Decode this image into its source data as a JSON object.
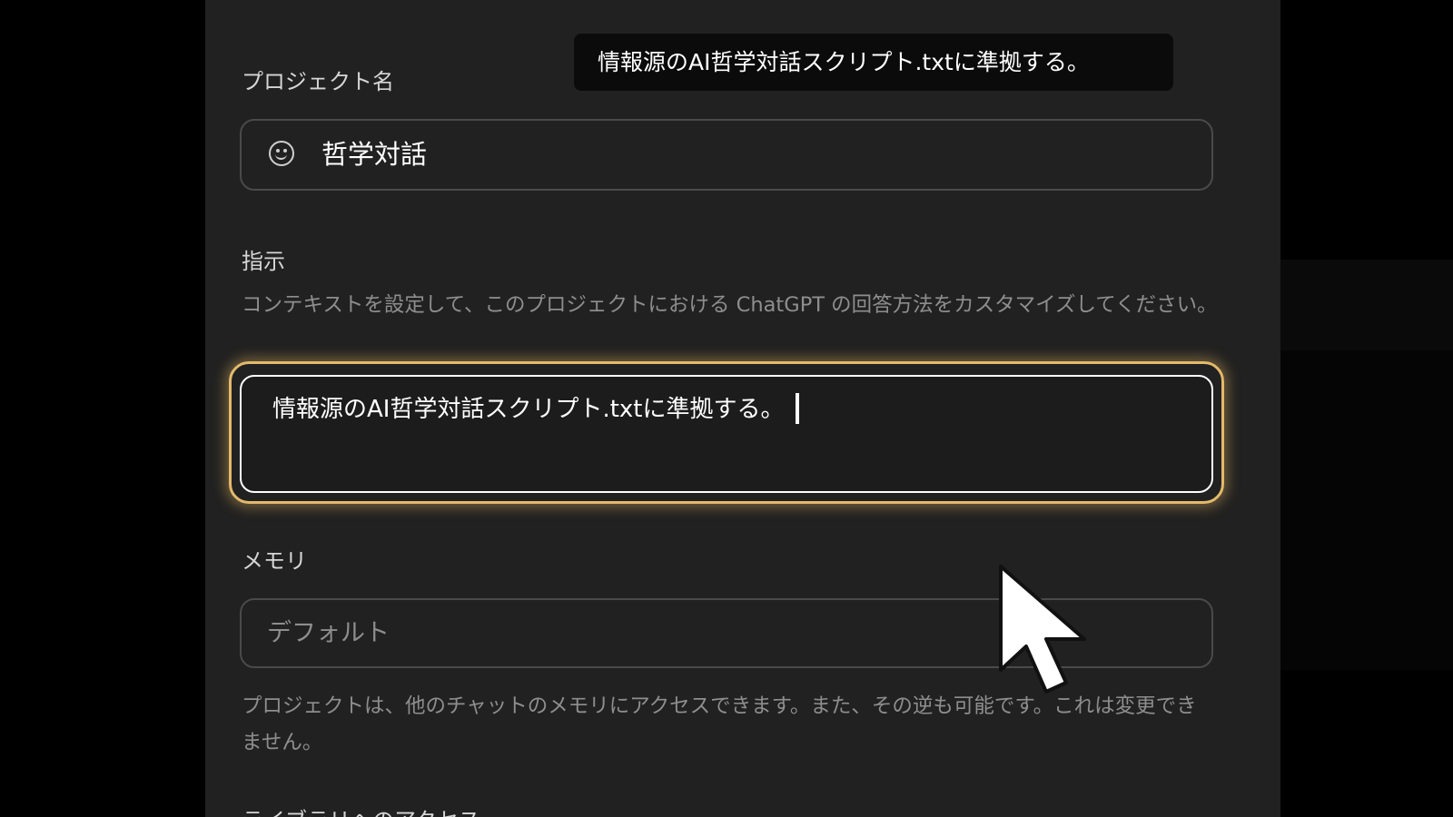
{
  "tooltip": {
    "text": "情報源のAI哲学対話スクリプト.txtに準拠する。"
  },
  "project_name": {
    "label": "プロジェクト名",
    "icon": "smiley-icon",
    "value": "哲学対話"
  },
  "instructions": {
    "label": "指示",
    "description": "コンテキストを設定して、このプロジェクトにおける ChatGPT の回答方法をカスタマイズしてください。",
    "value": "情報源のAI哲学対話スクリプト.txtに準拠する。",
    "focus_color": "#e3b96a"
  },
  "memory": {
    "label": "メモリ",
    "value": "デフォルト",
    "note": "プロジェクトは、他のチャットのメモリにアクセスできます。また、その逆も可能です。これは変更できません。"
  },
  "library": {
    "label": "ライブラリへのアクセス"
  }
}
